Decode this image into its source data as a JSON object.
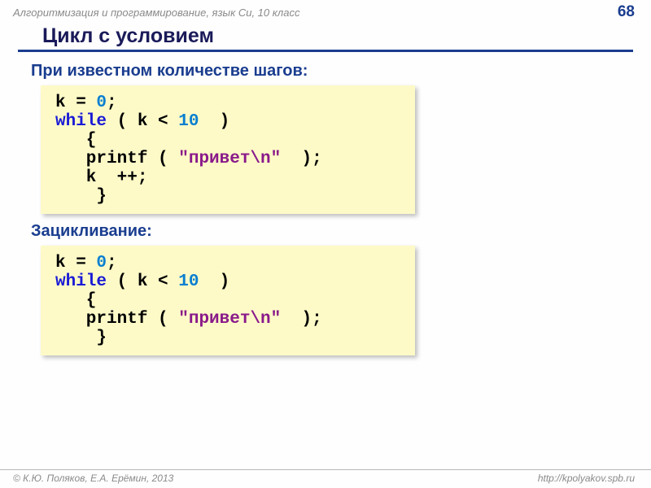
{
  "header": {
    "title": "Алгоритмизация и программирование, язык Си, 10 класс",
    "page": "68"
  },
  "title": "Цикл с условием",
  "section1": {
    "label": "При известном количестве шагов:",
    "code": {
      "lines": [
        [
          {
            "t": "k = ",
            "c": ""
          },
          {
            "t": "0",
            "c": "num"
          },
          {
            "t": ";",
            "c": ""
          }
        ],
        [
          {
            "t": "while",
            "c": "kw"
          },
          {
            "t": " ( k < ",
            "c": ""
          },
          {
            "t": "10",
            "c": "num"
          },
          {
            "t": "  )",
            "c": ""
          }
        ],
        [
          {
            "t": "   {",
            "c": ""
          }
        ],
        [
          {
            "t": "   printf ( ",
            "c": ""
          },
          {
            "t": "\"привет\\n\"",
            "c": "str"
          },
          {
            "t": "  );",
            "c": ""
          }
        ],
        [
          {
            "t": "   k  ++;",
            "c": ""
          }
        ],
        [
          {
            "t": "    }",
            "c": ""
          }
        ]
      ]
    }
  },
  "section2": {
    "label": "Зацикливание:",
    "code": {
      "lines": [
        [
          {
            "t": "k = ",
            "c": ""
          },
          {
            "t": "0",
            "c": "num"
          },
          {
            "t": ";",
            "c": ""
          }
        ],
        [
          {
            "t": "while",
            "c": "kw"
          },
          {
            "t": " ( k < ",
            "c": ""
          },
          {
            "t": "10",
            "c": "num"
          },
          {
            "t": "  )",
            "c": ""
          }
        ],
        [
          {
            "t": "   {",
            "c": ""
          }
        ],
        [
          {
            "t": "   printf ( ",
            "c": ""
          },
          {
            "t": "\"привет\\n\"",
            "c": "str"
          },
          {
            "t": "  );",
            "c": ""
          }
        ],
        [
          {
            "t": "    }",
            "c": ""
          }
        ]
      ]
    }
  },
  "footer": {
    "left": "© К.Ю. Поляков, Е.А. Ерёмин, 2013",
    "right": "http://kpolyakov.spb.ru"
  }
}
